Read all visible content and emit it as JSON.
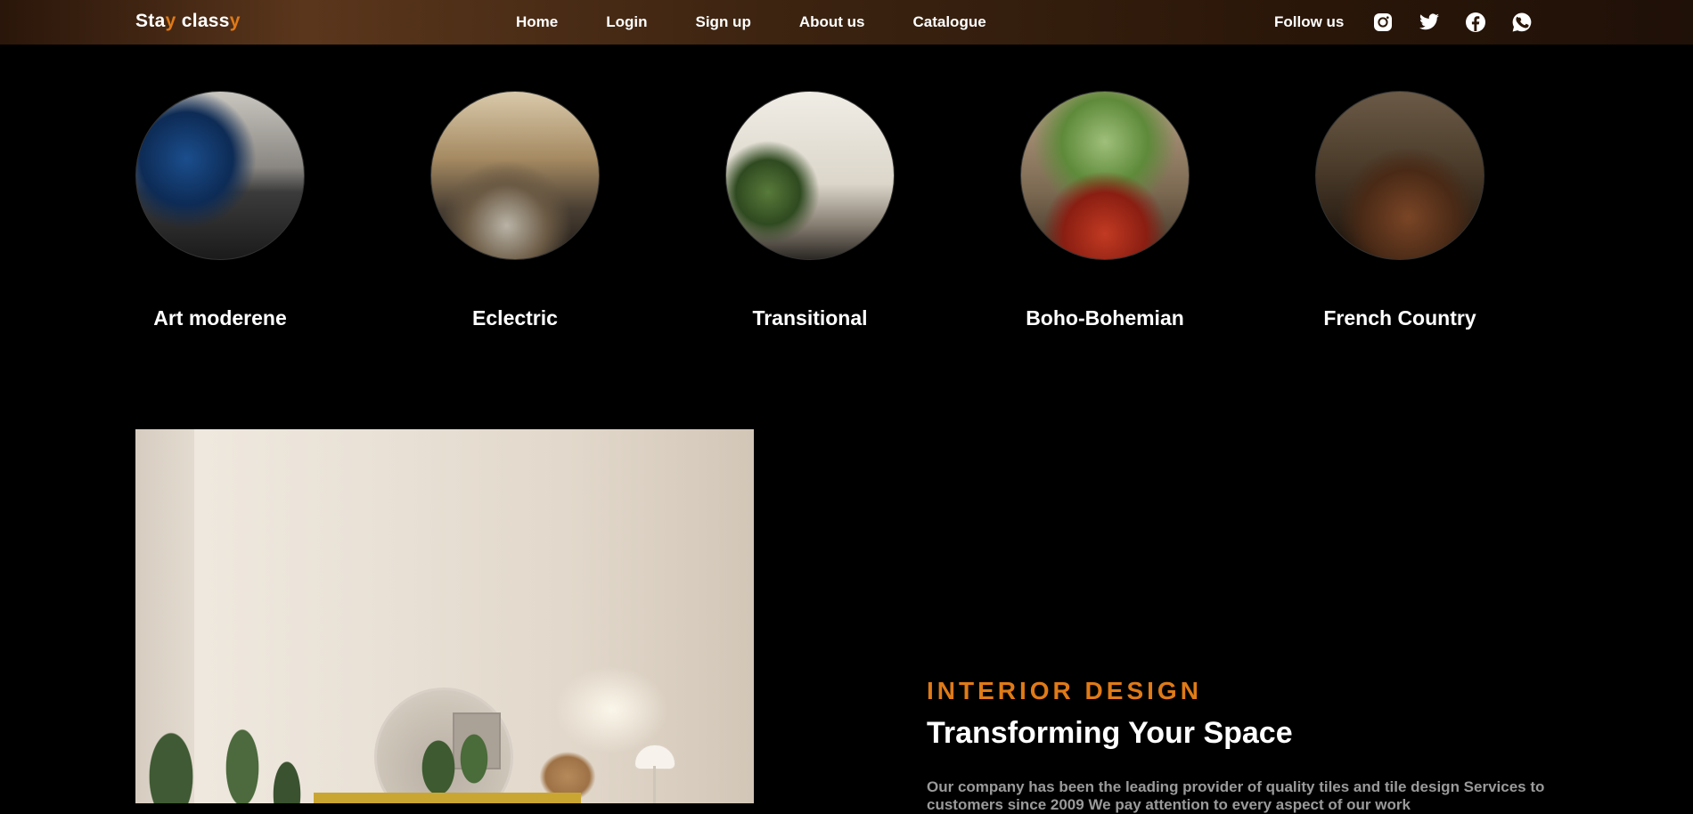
{
  "navbar": {
    "brand": {
      "part1": "Sta",
      "part2": "y",
      "part3": " class",
      "part4": "y"
    },
    "links": [
      "Home",
      "Login",
      "Sign up",
      "About us",
      "Catalogue"
    ],
    "follow_label": "Follow us",
    "socials": [
      "instagram-icon",
      "twitter-icon",
      "facebook-icon",
      "whatsapp-icon"
    ]
  },
  "styles": [
    {
      "name": "Art moderene"
    },
    {
      "name": "Eclectric"
    },
    {
      "name": "Transitional"
    },
    {
      "name": "Boho-Bohemian"
    },
    {
      "name": "French Country"
    }
  ],
  "about": {
    "eyebrow": "INTERIOR DESIGN",
    "headline": "Transforming Your Space",
    "body": "Our company has been the leading provider of quality tiles and tile design Services to customers since 2009 We pay attention to every aspect of our work"
  },
  "colors": {
    "accent": "#e07a17",
    "background": "#000000"
  }
}
